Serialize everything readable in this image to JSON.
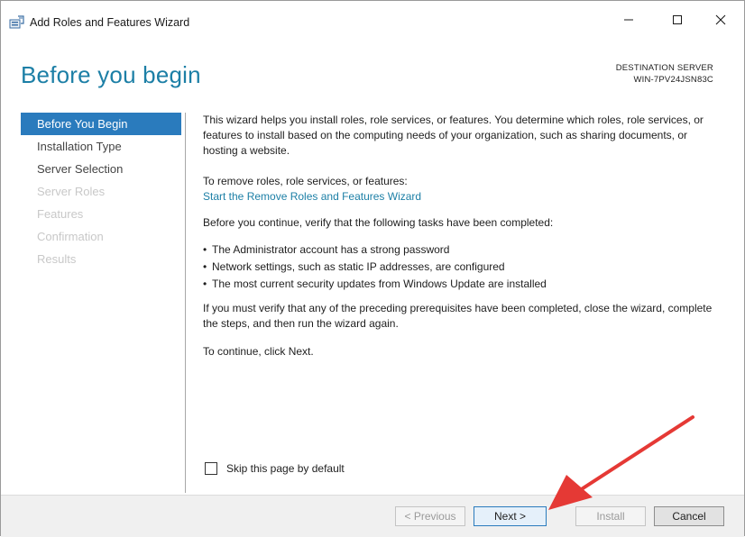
{
  "window": {
    "title": "Add Roles and Features Wizard",
    "controls": {
      "minimize": "—",
      "maximize": "☐",
      "close": "✕"
    }
  },
  "header": {
    "title": "Before you begin",
    "destination_label": "DESTINATION SERVER",
    "destination_server": "WIN-7PV24JSN83C"
  },
  "nav": {
    "items": [
      {
        "label": "Before You Begin",
        "state": "active"
      },
      {
        "label": "Installation Type",
        "state": "enabled"
      },
      {
        "label": "Server Selection",
        "state": "enabled"
      },
      {
        "label": "Server Roles",
        "state": "disabled"
      },
      {
        "label": "Features",
        "state": "disabled"
      },
      {
        "label": "Confirmation",
        "state": "disabled"
      },
      {
        "label": "Results",
        "state": "disabled"
      }
    ]
  },
  "content": {
    "intro": "This wizard helps you install roles, role services, or features. You determine which roles, role services, or features to install based on the computing needs of your organization, such as sharing documents, or hosting a website.",
    "remove_prompt": "To remove roles, role services, or features:",
    "remove_link": "Start the Remove Roles and Features Wizard",
    "verify_intro": "Before you continue, verify that the following tasks have been completed:",
    "bullets": [
      "The Administrator account has a strong password",
      "Network settings, such as static IP addresses, are configured",
      "The most current security updates from Windows Update are installed"
    ],
    "verify_note": "If you must verify that any of the preceding prerequisites have been completed, close the wizard, complete the steps, and then run the wizard again.",
    "continue_note": "To continue, click Next."
  },
  "skip_checkbox": {
    "label": "Skip this page by default",
    "checked": false
  },
  "footer": {
    "previous": "< Previous",
    "next": "Next >",
    "install": "Install",
    "cancel": "Cancel"
  },
  "colors": {
    "accent": "#2a7bbd",
    "title": "#1c7fa6",
    "annotation_arrow": "#e53935"
  }
}
